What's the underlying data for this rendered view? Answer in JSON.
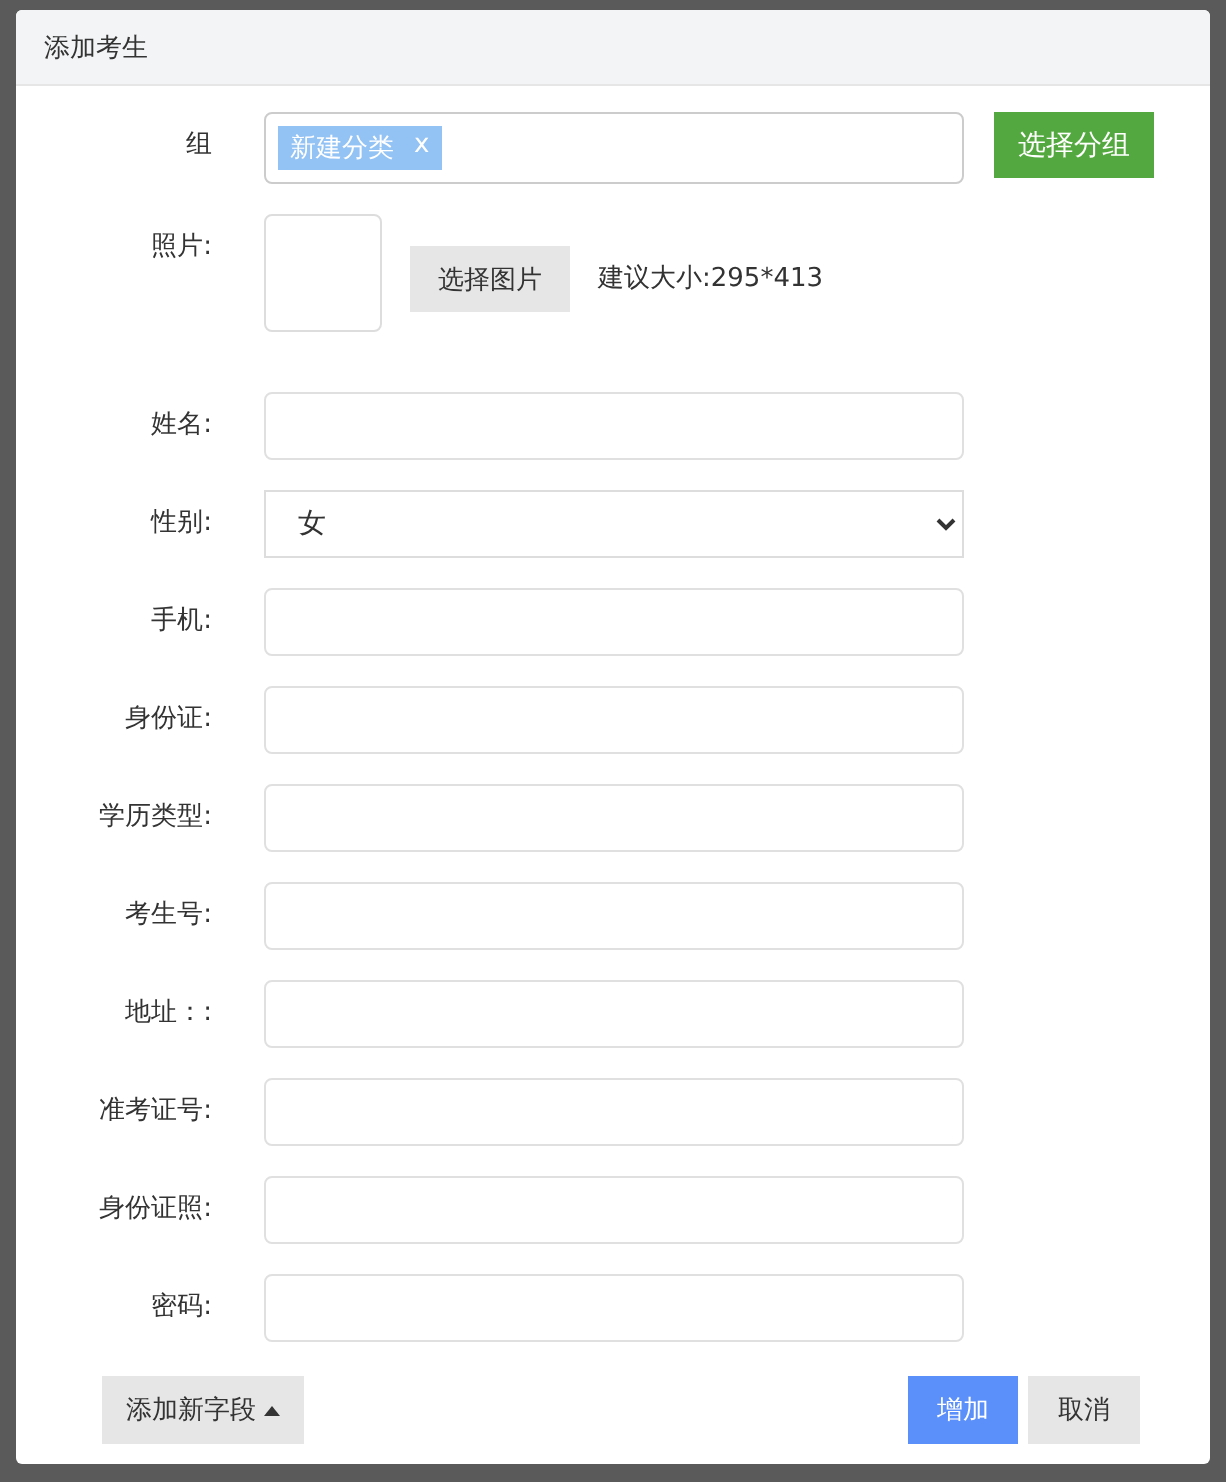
{
  "dialog": {
    "title": "添加考生"
  },
  "group": {
    "label": "组",
    "tags": [
      {
        "text": "新建分类",
        "remove": "x"
      }
    ],
    "button": "选择分组"
  },
  "photo": {
    "label": "照片:",
    "button": "选择图片",
    "hint": "建议大小:295*413"
  },
  "fields": [
    {
      "label": "姓名:",
      "kind": "text"
    },
    {
      "label": "性别:",
      "kind": "select",
      "value": "女"
    },
    {
      "label": "手机:",
      "kind": "text"
    },
    {
      "label": "身份证:",
      "kind": "text"
    },
    {
      "label": "学历类型:",
      "kind": "text"
    },
    {
      "label": "考生号:",
      "kind": "text"
    },
    {
      "label": "地址：:",
      "kind": "text"
    },
    {
      "label": "准考证号:",
      "kind": "text"
    },
    {
      "label": "身份证照:",
      "kind": "text"
    },
    {
      "label": "密码:",
      "kind": "text"
    }
  ],
  "footer": {
    "add_field": "添加新字段",
    "submit": "增加",
    "cancel": "取消"
  }
}
